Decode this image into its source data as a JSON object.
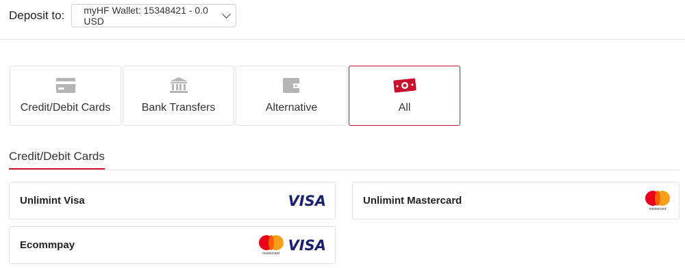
{
  "deposit": {
    "label": "Deposit to:",
    "wallet_value": "myHF Wallet: 15348421 - 0.0 USD"
  },
  "method_tabs": [
    {
      "label": "Credit/Debit Cards",
      "icon": "credit-card-icon",
      "active": false
    },
    {
      "label": "Bank Transfers",
      "icon": "bank-icon",
      "active": false
    },
    {
      "label": "Alternative",
      "icon": "wallet-icon",
      "active": false
    },
    {
      "label": "All",
      "icon": "money-icon",
      "active": true
    }
  ],
  "section": {
    "title": "Credit/Debit Cards"
  },
  "payment_methods": [
    {
      "name": "Unlimint Visa",
      "logos": [
        "visa"
      ]
    },
    {
      "name": "Unlimint Mastercard",
      "logos": [
        "mastercard"
      ]
    },
    {
      "name": "Ecommpay",
      "logos": [
        "mastercard",
        "visa"
      ]
    }
  ],
  "logo_text": {
    "visa": "VISA",
    "mastercard": "mastercard"
  },
  "colors": {
    "accent": "#c8102e",
    "icon_gray": "#b5b5b5",
    "visa_blue": "#1a1f71",
    "mc_red": "#eb001b",
    "mc_orange": "#f79e1b"
  }
}
